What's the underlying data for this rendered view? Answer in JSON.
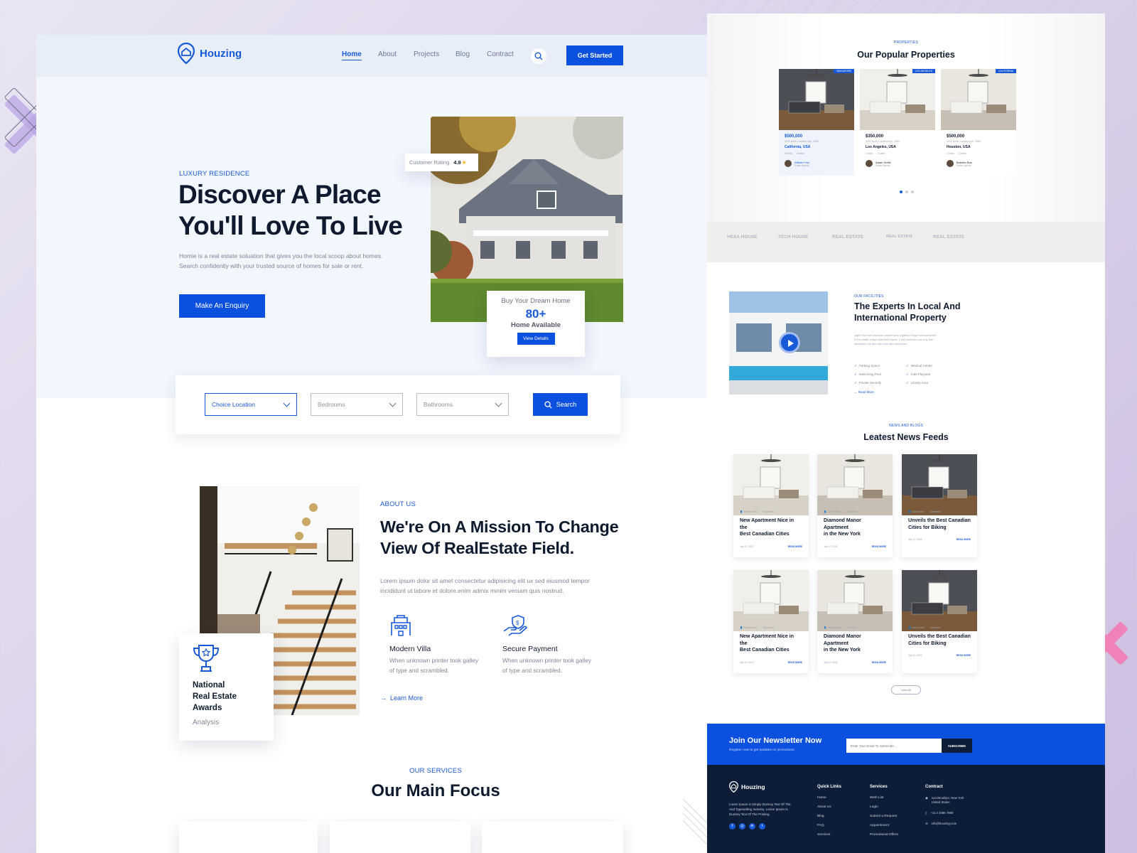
{
  "colors": {
    "brand": "#0c50df",
    "accent": "#1859d8",
    "dark": "#0e1b2f",
    "footer": "#0d1d37"
  },
  "brand": {
    "name": "Houzing"
  },
  "nav": {
    "items": [
      "Home",
      "About",
      "Projects",
      "Blog",
      "Contract"
    ],
    "active": "Home",
    "cta": "Get Started",
    "search_icon": "search-icon"
  },
  "hero": {
    "eyebrow": "LUXURY RESIDENCE",
    "title_line1": "Discover A Place",
    "title_line2": "You'll Love To Live",
    "desc_line1": "Homie is a real estate soluation that gives you the local scoop about homes.",
    "desc_line2": "Search confidently with your trusted source of homes for sale or rent.",
    "cta": "Make An Enquiry",
    "rating_label": "Customer Rating",
    "rating_value": "4.9",
    "dream": {
      "title": "Buy Your Dream Home",
      "count": "80+",
      "sub": "Home Available",
      "button": "View Details"
    }
  },
  "search": {
    "location": "Choice Location",
    "bedrooms": "Bedrooms",
    "bathrooms": "Bathrooms",
    "button": "Search"
  },
  "about": {
    "eyebrow": "ABOUT US",
    "title_line1": "We're On A Mission To Change",
    "title_line2": "View Of RealEstate Field.",
    "desc_line1": "Lorem ipsum dolor sit amet consectetur adipisicing elit ux sed eiusmod tempor",
    "desc_line2": "incididunt ut labore et dolore.enim admix minim veniam quis nostrud.",
    "features": [
      {
        "title": "Modern Villa",
        "desc_line1": "When unknown printer took galley",
        "desc_line2": "of type and scrambled.",
        "icon": "building-icon"
      },
      {
        "title": "Secure Payment",
        "desc_line1": "When unknown printer took galley",
        "desc_line2": "of type and scrambled.",
        "icon": "secure-payment-icon"
      }
    ],
    "link": "Learn More",
    "award": {
      "line1": "National",
      "line2": "Real Estate",
      "line3": "Awards",
      "sub": "Analysis",
      "icon": "trophy-icon"
    }
  },
  "services": {
    "eyebrow": "OUR SERVICES",
    "title": "Our Main Focus"
  },
  "properties": {
    "eyebrow": "PROPERTIES",
    "title": "Our Popular Properties",
    "items": [
      {
        "tag": "SINGAPORE",
        "price": "$500,000",
        "address": "3232 North Carolina Ave. 2380",
        "city": "California, USA",
        "meta1": "2 beds",
        "meta2": "2 baths",
        "agent": "William Hue",
        "role": "Estate Agents"
      },
      {
        "tag": "LOS ANGELES",
        "price": "$350,000",
        "address": "3232 North Carolina Ave. 2380",
        "city": "Los Angeles, USA",
        "meta1": "2 beds",
        "meta2": "2 baths",
        "agent": "Adam Smith",
        "role": "Estate Agents"
      },
      {
        "tag": "CALIFORNIA",
        "price": "$500,000",
        "address": "3232 North Carolina Ave. 2380",
        "city": "Houston, USA",
        "meta1": "2 beds",
        "meta2": "2 baths",
        "agent": "Butcher Bos",
        "role": "Estate Agents"
      }
    ]
  },
  "partners": [
    "HEXA HOUSE",
    "TECH HOUSE",
    "REAL ESTATE",
    "REAL ESTATE",
    "REAL ESTATE"
  ],
  "facilities": {
    "eyebrow": "OUR FACILITIES",
    "title_line1": "The Experts In Local And",
    "title_line2": "International Property",
    "desc_line1": "Agent Ken an unknown printer took a galley of type and scramble",
    "desc_line2": "it it to make a type specimen book. It has survived not only five",
    "desc_line3": "centuries, but also the leap into electronic.",
    "list": [
      "Parking Space",
      "Swimming Pool",
      "Private Security",
      "Medical Center",
      "Kids Playland",
      "Library Area"
    ],
    "link": "Read More"
  },
  "news": {
    "eyebrow": "NEWS AND BLOGS",
    "title": "Leatest News Feeds",
    "items": [
      {
        "author": "William Bates",
        "cat": "Apartment",
        "t1": "New Apartment Nice in the",
        "t2": "Best Canadian Cities",
        "date": "July 10, 2022",
        "more": "READ MORE"
      },
      {
        "author": "Michel Bates",
        "cat": "Apartment",
        "t1": "Diamond Manor Apartment",
        "t2": "in the New York",
        "date": "July 10, 2022",
        "more": "READ MORE"
      },
      {
        "author": "Adam Smith",
        "cat": "Apartment",
        "t1": "Unveils the Best Canadian",
        "t2": "Cities for Biking",
        "date": "July 10, 2022",
        "more": "READ MORE"
      },
      {
        "author": "William Bates",
        "cat": "Apartment",
        "t1": "New Apartment Nice in the",
        "t2": "Best Canadian Cities",
        "date": "July 10, 2022",
        "more": "READ MORE"
      },
      {
        "author": "Michel Bates",
        "cat": "Apartment",
        "t1": "Diamond Manor Apartment",
        "t2": "in the New York",
        "date": "July 10, 2022",
        "more": "READ MORE"
      },
      {
        "author": "Adam Smith",
        "cat": "Apartment",
        "t1": "Unveils the Best Canadian",
        "t2": "Cities for Biking",
        "date": "July 10, 2022",
        "more": "READ MORE"
      }
    ],
    "view_all": "View All"
  },
  "newsletter": {
    "title": "Join Our Newsletter Now",
    "sub": "Register now to get updates on promotions.",
    "placeholder": "Enter Your Email To Subscribe...",
    "button": "SUBSCRIBE"
  },
  "footer": {
    "desc_line1": "Lorem Ipsum is Simply Dummy Text Of The",
    "desc_line2": "And Typesetting Industry. Lorem Ipsum Is",
    "desc_line3": "Dummy Text Of The Printing.",
    "quick_title": "Quick Links",
    "quick": [
      "Home",
      "About Us",
      "Blog",
      "FAQ",
      "Services"
    ],
    "services_title": "Services",
    "services": [
      "Wish List",
      "Login",
      "Submit a Request",
      "Appointment",
      "Promotional Offers"
    ],
    "contact_title": "Contract",
    "address_line1": "124 Brooklyn, New York",
    "address_line2": "United States",
    "phone": "+11 2 3456 7890",
    "email": "info@houzing.com"
  }
}
